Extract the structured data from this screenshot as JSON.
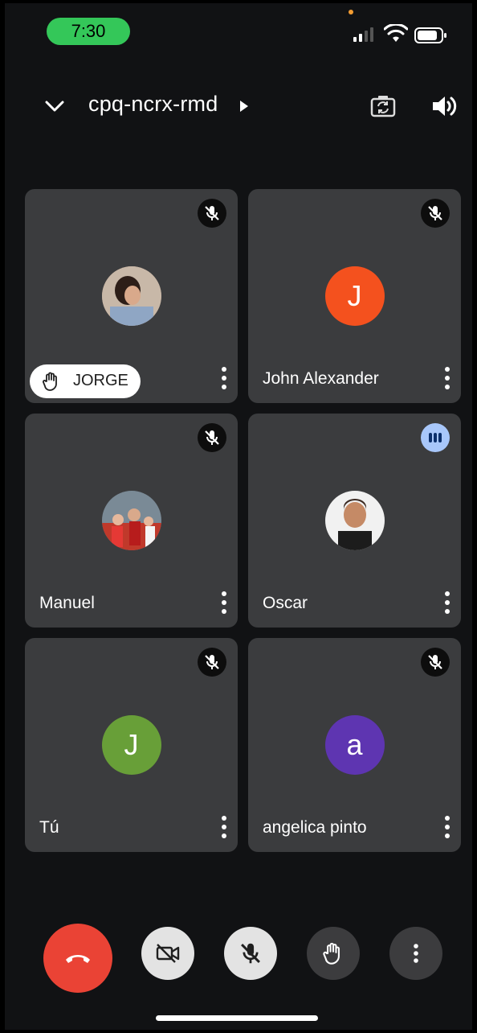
{
  "status_bar": {
    "time": "7:30",
    "signal_icon": "cellular-signal-icon",
    "wifi_icon": "wifi-icon",
    "battery_icon": "battery-icon"
  },
  "header": {
    "meeting_code": "cpq-ncrx-rmd",
    "icons": [
      "chevron-down-icon",
      "caret-right-icon",
      "switch-camera-icon",
      "speaker-icon"
    ]
  },
  "participants": [
    {
      "name": "JORGE",
      "avatar_type": "photo",
      "mic_status": "muted",
      "hand_raised": true
    },
    {
      "name": "John Alexander",
      "avatar_type": "initial",
      "initial": "J",
      "avatar_color": "#f4511e",
      "mic_status": "muted",
      "hand_raised": false
    },
    {
      "name": "Manuel",
      "avatar_type": "photo",
      "mic_status": "muted",
      "hand_raised": false
    },
    {
      "name": "Oscar",
      "avatar_type": "photo",
      "mic_status": "speaking",
      "hand_raised": false
    },
    {
      "name": "Tú",
      "avatar_type": "initial",
      "initial": "J",
      "avatar_color": "#689f38",
      "mic_status": "muted",
      "hand_raised": false
    },
    {
      "name": "angelica pinto",
      "avatar_type": "initial",
      "initial": "a",
      "avatar_color": "#5e35b1",
      "mic_status": "muted",
      "hand_raised": false
    }
  ],
  "controls": {
    "end_call_color": "#ea4335",
    "buttons": [
      "end-call-button",
      "camera-toggle-button",
      "mic-toggle-button",
      "raise-hand-button",
      "more-options-button"
    ]
  },
  "colors": {
    "background": "#111214",
    "tile": "#3b3c3e",
    "time_pill": "#34c759",
    "speaking_badge": "#a8c7fa"
  }
}
